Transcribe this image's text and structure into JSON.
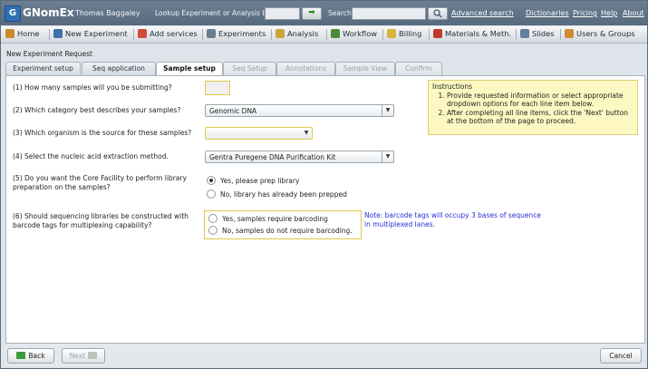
{
  "header": {
    "logo_letter": "G",
    "brand": "GNomEx",
    "user": "Thomas Baggaley",
    "lookup_label": "Lookup Experiment or Analysis by #",
    "lookup_value": "",
    "go_label": "➡",
    "search_label": "Search",
    "search_value": "",
    "advanced_search": "Advanced search",
    "links": [
      "Dictionaries",
      "Pricing",
      "Help",
      "About"
    ]
  },
  "nav": [
    {
      "label": "Home",
      "icon": "home-icon",
      "color": "#c98a2b"
    },
    {
      "label": "New Experiment",
      "icon": "flask-icon",
      "color": "#3d6fa8"
    },
    {
      "label": "Add services",
      "icon": "add-services-icon",
      "color": "#d24a3a"
    },
    {
      "label": "Experiments",
      "icon": "flask-icon",
      "color": "#6a7d8f"
    },
    {
      "label": "Analysis",
      "icon": "chart-icon",
      "color": "#c9a63a"
    },
    {
      "label": "Workflow",
      "icon": "workflow-icon",
      "color": "#4a8a3a"
    },
    {
      "label": "Billing",
      "icon": "billing-icon",
      "color": "#d9b441"
    },
    {
      "label": "Materials & Meth.",
      "icon": "materials-icon",
      "color": "#c0392b"
    },
    {
      "label": "Slides",
      "icon": "slides-icon",
      "color": "#5f7f9f"
    },
    {
      "label": "Users & Groups",
      "icon": "users-icon",
      "color": "#d08a30"
    }
  ],
  "page": {
    "title": "New Experiment Request",
    "tabs": [
      {
        "label": "Experiment setup",
        "state": "normal"
      },
      {
        "label": "Seq application",
        "state": "normal"
      },
      {
        "label": "Sample setup",
        "state": "active"
      },
      {
        "label": "Seq Setup",
        "state": "disabled"
      },
      {
        "label": "Annotations",
        "state": "disabled"
      },
      {
        "label": "Sample View",
        "state": "disabled"
      },
      {
        "label": "Confirm",
        "state": "disabled"
      }
    ]
  },
  "questions": {
    "q1": "(1) How many samples will you be submitting?",
    "q1_value": "",
    "q2": "(2) Which category best describes your samples?",
    "q2_value": "Genomic DNA",
    "q3": "(3) Which organism is the source for these samples?",
    "q3_value": "",
    "q4": "(4) Select the nucleic acid extraction method.",
    "q4_value": "Gentra Puregene DNA Purification Kit",
    "q5_line1": "(5) Do you want the Core Facility to perform library",
    "q5_line2": "preparation on the samples?",
    "q5_options": [
      "Yes, please prep library",
      "No, library has already been prepped"
    ],
    "q5_selected": 0,
    "q6_line1": "(6) Should sequencing libraries be constructed with",
    "q6_line2": "barcode tags for multiplexing capability?",
    "q6_options": [
      "Yes, samples require barcoding",
      "No, samples do not require barcoding."
    ],
    "q6_selected": -1,
    "note_line1": "Note: barcode tags will occupy 3 bases of sequence",
    "note_line2": "in multiplexed lanes."
  },
  "instructions": {
    "title": "Instructions",
    "items": [
      "Provide requested information or select appropriate dropdown options for each line item below.",
      "After completing all line items, click the 'Next' button at the bottom of the page to proceed."
    ]
  },
  "footer": {
    "back": "Back",
    "next": "Next",
    "cancel": "Cancel"
  }
}
